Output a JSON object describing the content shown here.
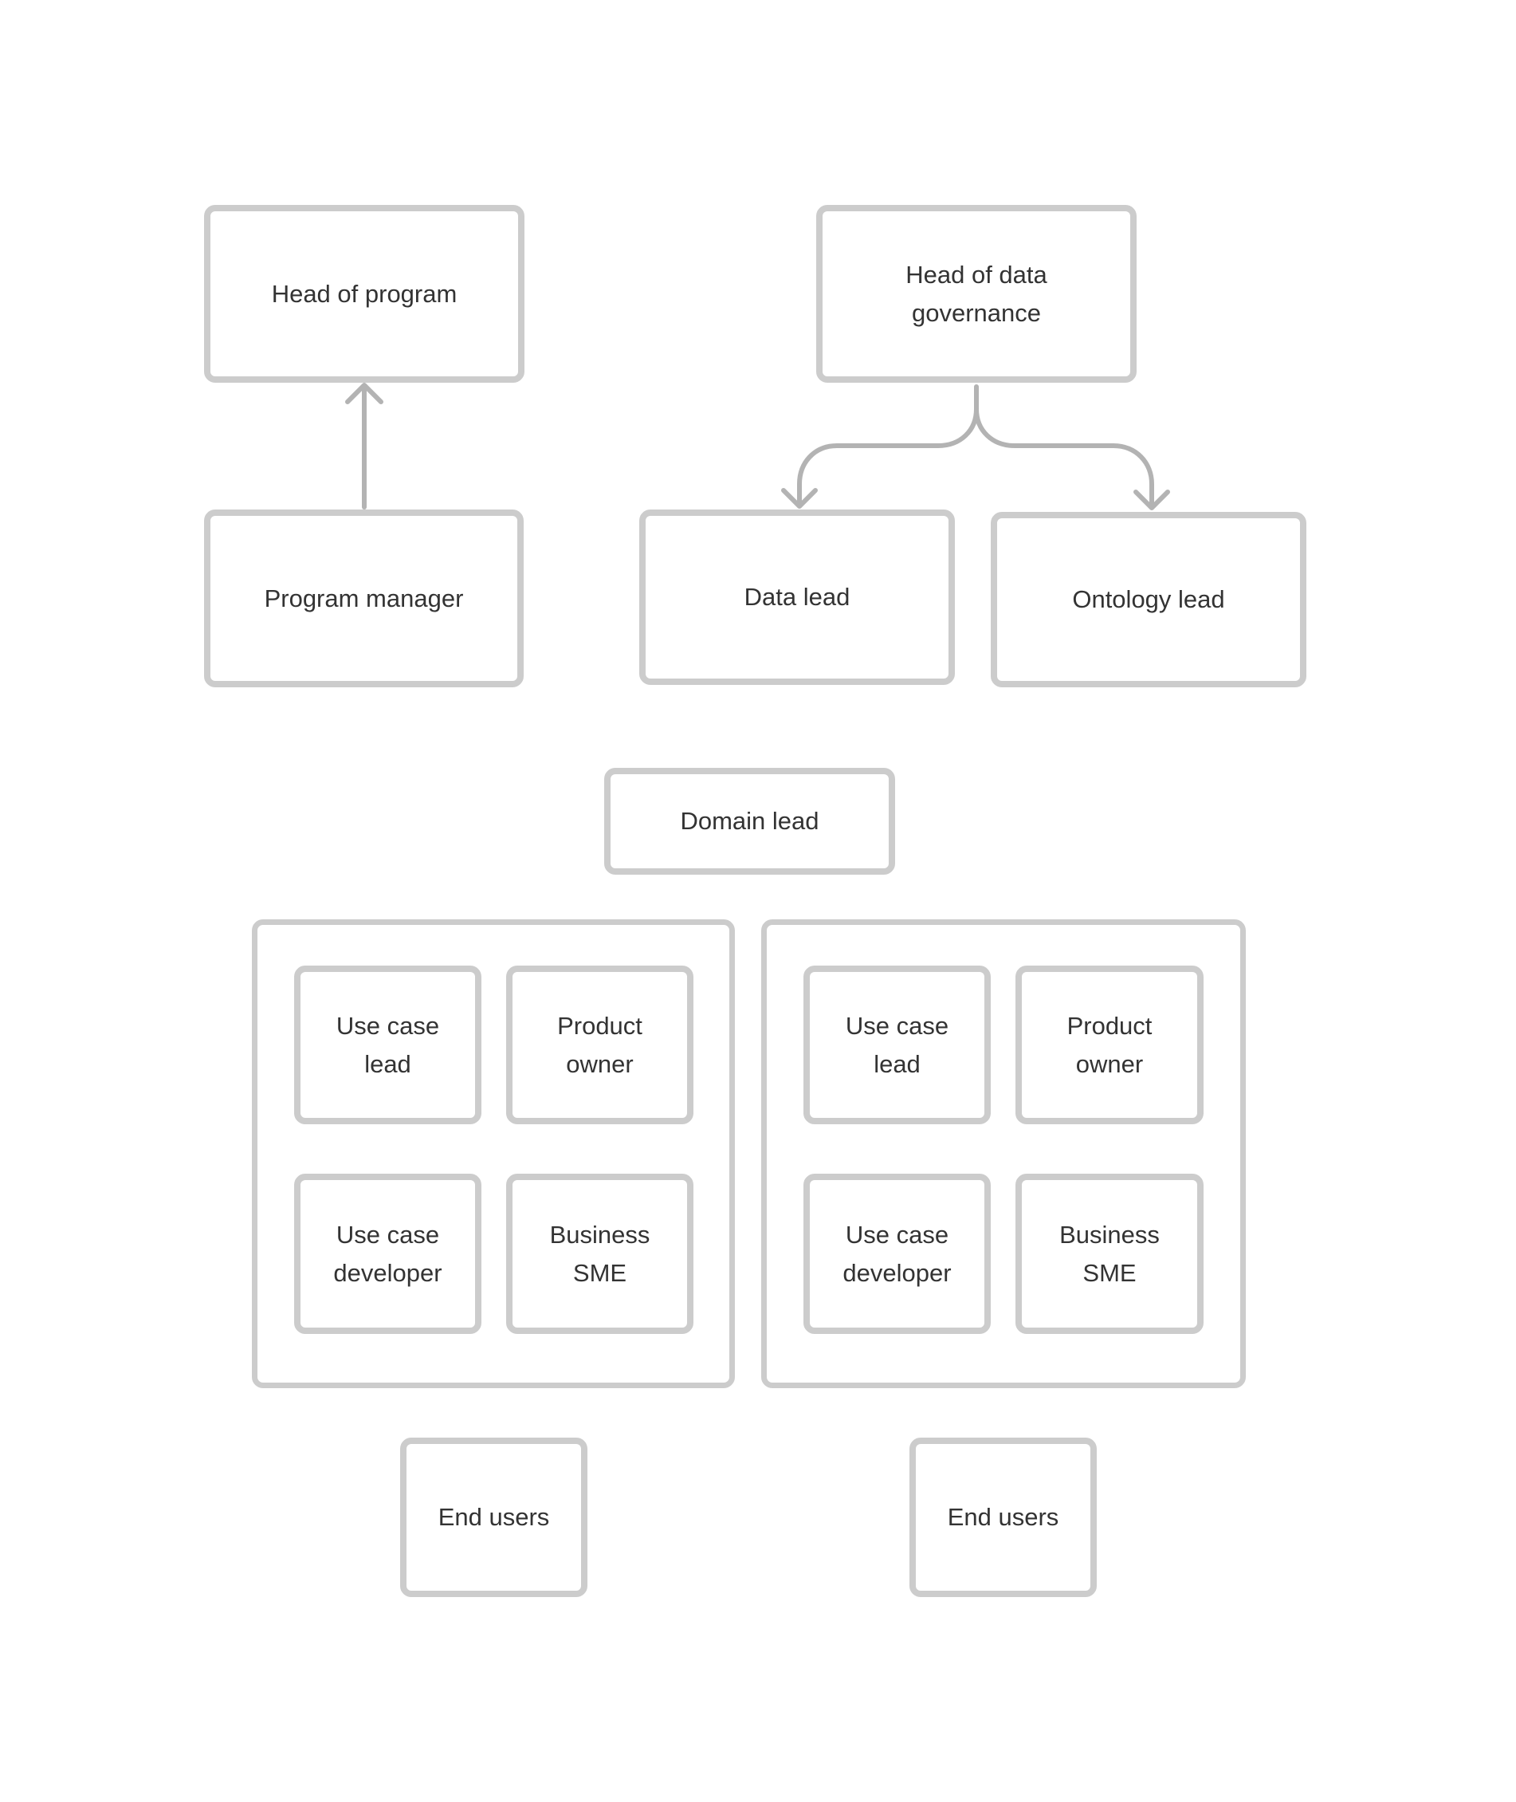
{
  "diagram": {
    "nodes": {
      "head_of_program": "Head of program",
      "head_of_data_governance": "Head of data\ngovernance",
      "program_manager": "Program manager",
      "data_lead": "Data lead",
      "ontology_lead": "Ontology lead",
      "domain_lead": "Domain lead"
    },
    "groups": [
      {
        "members": [
          "Use case\nlead",
          "Product\nowner",
          "Use case\ndeveloper",
          "Business\nSME"
        ],
        "end_users": "End users"
      },
      {
        "members": [
          "Use case\nlead",
          "Product\nowner",
          "Use case\ndeveloper",
          "Business\nSME"
        ],
        "end_users": "End users"
      }
    ],
    "edges": [
      {
        "from": "program_manager",
        "to": "head_of_program",
        "style": "arrow"
      },
      {
        "from": "head_of_data_governance",
        "to": "data_lead",
        "style": "branch-arrow"
      },
      {
        "from": "head_of_data_governance",
        "to": "ontology_lead",
        "style": "branch-arrow"
      }
    ],
    "colors": {
      "box_border": "#cccccc",
      "connector": "#b3b3b3",
      "text": "#333333",
      "background": "#ffffff"
    }
  }
}
